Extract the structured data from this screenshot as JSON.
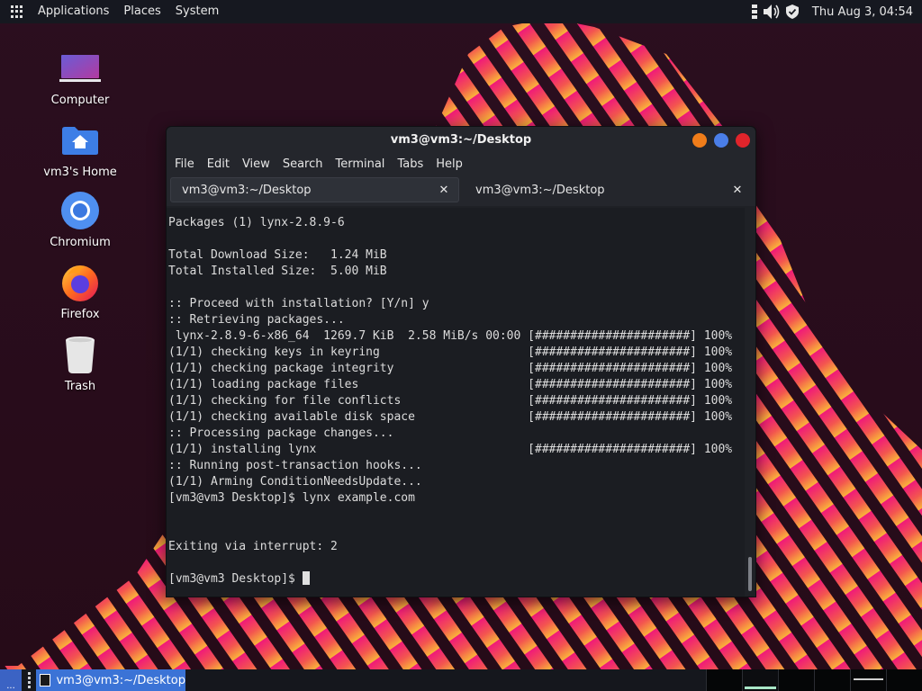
{
  "top_panel": {
    "menu": [
      "Applications",
      "Places",
      "System"
    ],
    "clock": "Thu Aug  3, 04:54",
    "tray_icons": [
      "keyboard-layout-icon",
      "volume-icon",
      "shield-icon"
    ]
  },
  "desktop_icons": [
    {
      "label": "Computer",
      "icon": "computer-icon"
    },
    {
      "label": "vm3's Home",
      "icon": "home-folder-icon"
    },
    {
      "label": "Chromium",
      "icon": "chromium-icon"
    },
    {
      "label": "Firefox",
      "icon": "firefox-icon"
    },
    {
      "label": "Trash",
      "icon": "trash-icon"
    }
  ],
  "window": {
    "title": "vm3@vm3:~/Desktop",
    "menu": [
      "File",
      "Edit",
      "View",
      "Search",
      "Terminal",
      "Tabs",
      "Help"
    ],
    "tabs": [
      {
        "title": "vm3@vm3:~/Desktop",
        "active": true
      },
      {
        "title": "vm3@vm3:~/Desktop",
        "active": false
      }
    ],
    "buttons": {
      "minimize": "#f07d1a",
      "maximize": "#4a7ee8",
      "close": "#e0242b"
    }
  },
  "terminal": {
    "lines": [
      "Packages (1) lynx-2.8.9-6",
      "",
      "Total Download Size:   1.24 MiB",
      "Total Installed Size:  5.00 MiB",
      "",
      ":: Proceed with installation? [Y/n] y",
      ":: Retrieving packages...",
      " lynx-2.8.9-6-x86_64  1269.7 KiB  2.58 MiB/s 00:00 [######################] 100%",
      "(1/1) checking keys in keyring                     [######################] 100%",
      "(1/1) checking package integrity                   [######################] 100%",
      "(1/1) loading package files                        [######################] 100%",
      "(1/1) checking for file conflicts                  [######################] 100%",
      "(1/1) checking available disk space                [######################] 100%",
      ":: Processing package changes...",
      "(1/1) installing lynx                              [######################] 100%",
      ":: Running post-transaction hooks...",
      "(1/1) Arming ConditionNeedsUpdate...",
      "[vm3@vm3 Desktop]$ lynx example.com",
      "",
      "",
      "Exiting via interrupt: 2",
      "",
      "[vm3@vm3 Desktop]$ "
    ]
  },
  "bottom_panel": {
    "show_desktop_label": "...",
    "task": "vm3@vm3:~/Desktop",
    "workspace_count": 6
  },
  "colors": {
    "panel": "#161820",
    "accent": "#3b73d6",
    "wallpaper_pink": "#f0197a",
    "wallpaper_orange": "#f7963b"
  }
}
